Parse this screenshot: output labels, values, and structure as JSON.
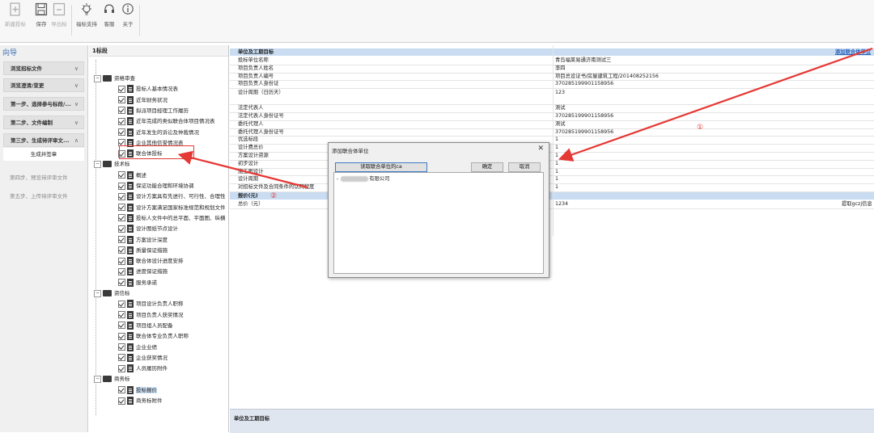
{
  "toolbar": {
    "buttons": [
      {
        "label": "新建投标",
        "icon": "new-document-icon",
        "enabled": false
      },
      {
        "label": "保存",
        "icon": "save-icon",
        "enabled": true
      },
      {
        "label": "导出标",
        "icon": "export-icon",
        "enabled": false
      },
      {
        "label": "福标支持",
        "icon": "lightbulb-icon",
        "enabled": true
      },
      {
        "label": "客服",
        "icon": "headset-icon",
        "enabled": true
      },
      {
        "label": "关于",
        "icon": "info-icon",
        "enabled": true
      }
    ]
  },
  "nav": {
    "title": "向导",
    "steps": [
      {
        "label": "浏览招标文件",
        "chevron": "∨"
      },
      {
        "label": "浏览澄清/变更",
        "chevron": "∨"
      },
      {
        "label": "第一步、选择参与标段/...",
        "chevron": "∨"
      },
      {
        "label": "第二步、文件编制",
        "chevron": "∨"
      },
      {
        "label": "第三步、生成待评审文...",
        "chevron": "∧"
      }
    ],
    "sub_item": "生成并签章",
    "plain_steps": [
      "第四步、预览待评审文件",
      "第五步、上传待评审文件"
    ]
  },
  "tree": {
    "header": "1标段",
    "groups": [
      {
        "label": "资格审查",
        "items": [
          "投标人基本情况表",
          "近年财务状况",
          "拟派项目经理工作履历",
          "近年完成的类似联合体项目情况表",
          "近年发生的诉讼及仲裁情况",
          "企业其他信誉情况表",
          "联合体投标"
        ]
      },
      {
        "label": "技术标",
        "items": [
          "概述",
          "保证功能合理和环境协调",
          "设计方案具有先进行、可行性、合理性",
          "设计方案满足国家标准规范和规划文件",
          "投标人文件中的总平面、平面图、纵横",
          "设计图纸节点设计",
          "方案设计深度",
          "质量保证措施",
          "联合体设计进度安排",
          "进度保证措施",
          "服务承诺"
        ]
      },
      {
        "label": "资信标",
        "items": [
          "项目设计负责人职称",
          "项目负责人获奖情况",
          "项目组人员配备",
          "联合体专业负责人职称",
          "企业业绩",
          "企业获奖情况",
          "人员履历附件"
        ]
      },
      {
        "label": "商务标",
        "items": [
          "投标报价",
          "商务标附件"
        ]
      }
    ]
  },
  "grid": {
    "section1_title": "单位及工期目标",
    "add_link": "添加联合体单位",
    "rows": [
      {
        "k": "投标单位名称",
        "v": "青岛福莱易通济南测试三"
      },
      {
        "k": "项目负责人姓名",
        "v": "李四"
      },
      {
        "k": "项目负责人编号",
        "v": "项目总设证书/房屋建筑工程/201408252156"
      },
      {
        "k": "项目负责人身份证",
        "v": "370285199901158956"
      },
      {
        "k": "设计周期（日历天）",
        "v": "123"
      },
      {
        "k": "法定代表人",
        "v": "测试"
      },
      {
        "k": "法定代表人身份证号",
        "v": "370285199901158956"
      },
      {
        "k": "委托代理人",
        "v": "测试"
      },
      {
        "k": "委托代理人身份证号",
        "v": "370285199901158956"
      },
      {
        "k": "优选标段",
        "v": "1"
      },
      {
        "k": "设计费总价",
        "v": "1"
      },
      {
        "k": "方案设计资源",
        "v": "1"
      },
      {
        "k": "初步设计",
        "v": "1"
      },
      {
        "k": "施工图设计",
        "v": "1"
      },
      {
        "k": "设计周期",
        "v": "1"
      },
      {
        "k": "对招标文件及合同条件的认同程度",
        "v": "1"
      }
    ],
    "section2_title": "报价(元)",
    "price_row": {
      "k": "总价（元）",
      "v": "1234",
      "action": "提取gczj信息"
    },
    "bottom_title": "单位及工期目标"
  },
  "dialog": {
    "title": "添加联合体单位",
    "read_button": "读取联合单位的ca",
    "confirm_button": "确定",
    "cancel_button": "取消",
    "item_prefix": "-",
    "item_suffix": "有限公司"
  },
  "annotations": {
    "marker1": "①",
    "marker2": "②",
    "color": "#e53935"
  }
}
